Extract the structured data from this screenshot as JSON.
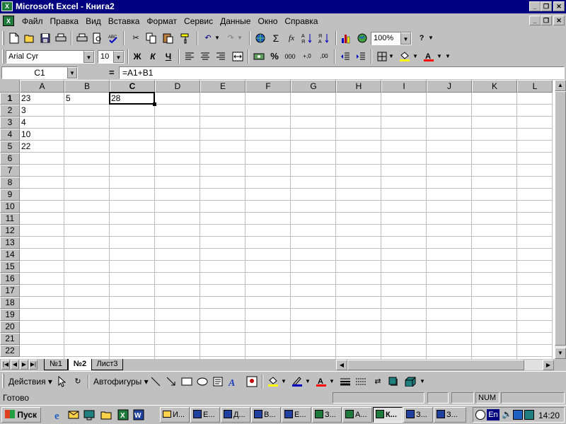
{
  "window": {
    "title": "Microsoft Excel - Книга2",
    "app_icon": "excel-icon",
    "controls": [
      "_",
      "❐",
      "✕"
    ]
  },
  "menu": {
    "items": [
      "Файл",
      "Правка",
      "Вид",
      "Вставка",
      "Формат",
      "Сервис",
      "Данные",
      "Окно",
      "Справка"
    ],
    "doc_controls": [
      "_",
      "❐",
      "✕"
    ]
  },
  "toolbar_standard": {
    "zoom": "100%",
    "icons": [
      "new-icon",
      "open-icon",
      "save-icon",
      "print-icon",
      "print-preview-icon",
      "spelling-icon",
      "cut-icon",
      "copy-icon",
      "paste-icon",
      "format-painter-icon",
      "undo-icon",
      "redo-icon",
      "hyperlink-icon",
      "autosum-icon",
      "function-icon",
      "sort-asc-icon",
      "sort-desc-icon",
      "chart-wizard-icon",
      "map-icon",
      "help-icon"
    ],
    "autosum_label": "Σ",
    "function_label": "fx"
  },
  "toolbar_formatting": {
    "font": "Arial Cyr",
    "size": "10",
    "bold": "Ж",
    "italic": "К",
    "underline": "Ч",
    "percent": "%",
    "thousands": "000",
    "inc_decimal": "+,0",
    "dec_decimal": ",00"
  },
  "formula_bar": {
    "name_box": "C1",
    "equals": "=",
    "formula": "=A1+B1"
  },
  "grid": {
    "columns": [
      "A",
      "B",
      "C",
      "D",
      "E",
      "F",
      "G",
      "H",
      "I",
      "J",
      "K",
      "L"
    ],
    "rows": [
      "1",
      "2",
      "3",
      "4",
      "5",
      "6",
      "7",
      "8",
      "9",
      "10",
      "11",
      "12",
      "13",
      "14",
      "15",
      "16",
      "17",
      "18",
      "19",
      "20",
      "21",
      "22"
    ],
    "active_column": "C",
    "active_row": "1",
    "cells": {
      "A1": "23",
      "B1": "5",
      "C1": "28",
      "A2": "3",
      "A3": "4",
      "A4": "10",
      "A5": "22"
    }
  },
  "sheets": {
    "tabs": [
      "№1",
      "№2",
      "Лист3"
    ],
    "active": "№2"
  },
  "drawing_toolbar": {
    "actions": "Действия",
    "autoshapes": "Автофигуры"
  },
  "status": {
    "text": "Готово",
    "num": "NUM"
  },
  "taskbar": {
    "start": "Пуск",
    "buttons": [
      "И...",
      "Е...",
      "Д...",
      "В...",
      "Е...",
      "З...",
      "А...",
      "К...",
      "З...",
      "З..."
    ],
    "active_index": 7,
    "lang": "En",
    "clock": "14:20"
  },
  "colors": {
    "titlebar": "#000080",
    "face": "#c0c0c0",
    "grid_line": "#c0c0c0",
    "excel_green": "#1e7a3a"
  }
}
